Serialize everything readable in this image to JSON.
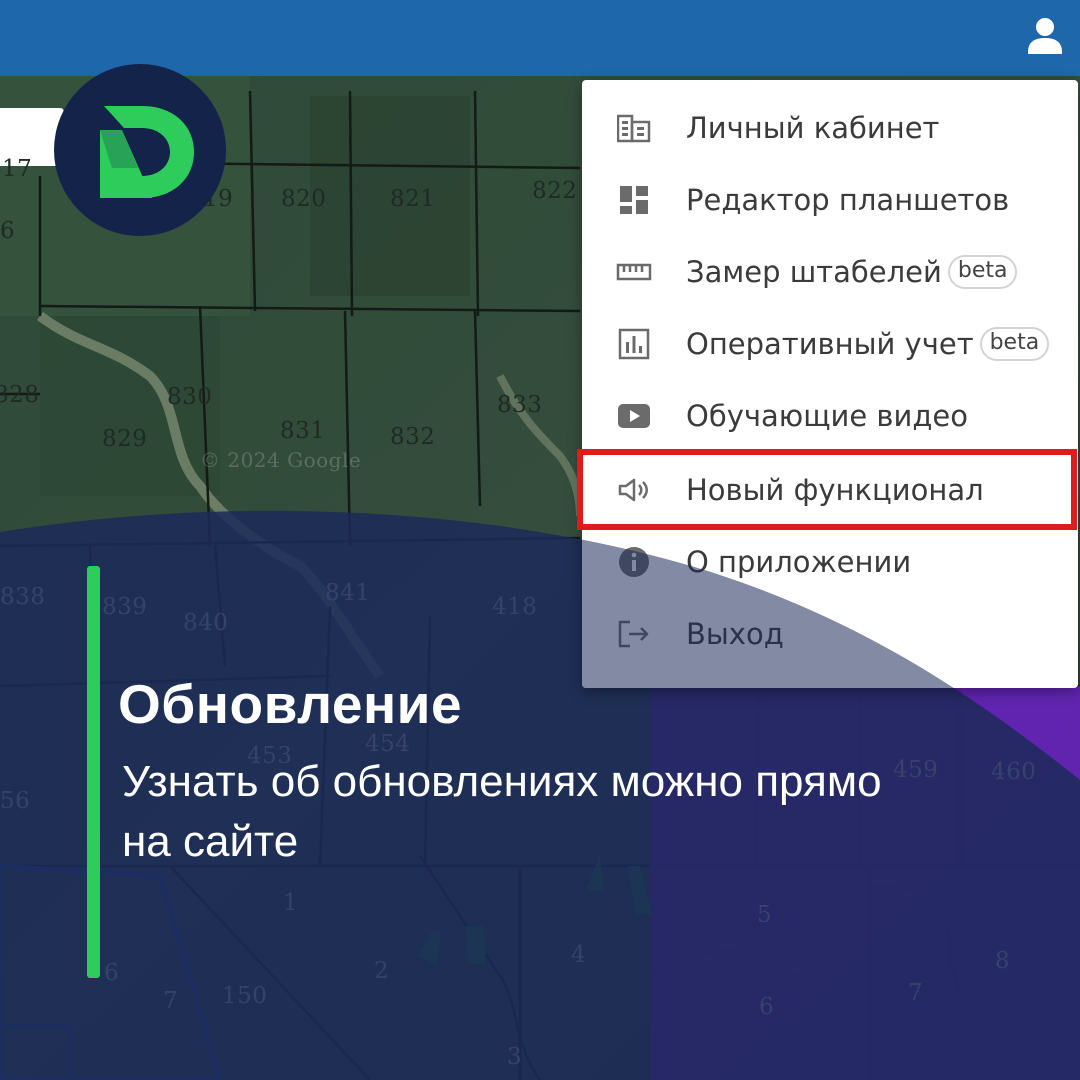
{
  "app": {
    "accent_color": "#1f67ab",
    "user_icon": "account-icon",
    "logo_text": "D"
  },
  "menu": {
    "items": [
      {
        "label": "Личный кабинет",
        "icon": "cabinet-icon",
        "badge": ""
      },
      {
        "label": "Редактор планшетов",
        "icon": "dashboard-icon",
        "badge": ""
      },
      {
        "label": "Замер штабелей",
        "icon": "ruler-icon",
        "badge": "beta"
      },
      {
        "label": "Оперативный учет",
        "icon": "chart-icon",
        "badge": "beta"
      },
      {
        "label": "Обучающие видео",
        "icon": "video-icon",
        "badge": ""
      },
      {
        "label": "Новый функционал",
        "icon": "megaphone-icon",
        "badge": "",
        "highlighted": true
      },
      {
        "label": "О приложении",
        "icon": "info-icon",
        "badge": ""
      },
      {
        "label": "Выход",
        "icon": "logout-icon",
        "badge": ""
      }
    ],
    "highlight_color": "#e01b1b"
  },
  "map": {
    "plots_top": [
      "17",
      "6",
      "19",
      "820",
      "821",
      "822"
    ],
    "plots_mid": [
      "828",
      "829",
      "830",
      "831",
      "832",
      "833"
    ],
    "plots_lower": [
      "838",
      "839",
      "840",
      "841",
      "418"
    ],
    "plots_bottom": [
      "453",
      "454",
      "459",
      "460",
      "56",
      "1",
      "2",
      "4",
      "5",
      "6",
      "6",
      "7",
      "7",
      "8",
      "150",
      "3"
    ],
    "watermark": "© 2024 Google"
  },
  "banner": {
    "headline": "Обновление",
    "subline": "Узнать об обновлениях можно прямо на сайте",
    "accent_color": "#2ecc5a"
  }
}
